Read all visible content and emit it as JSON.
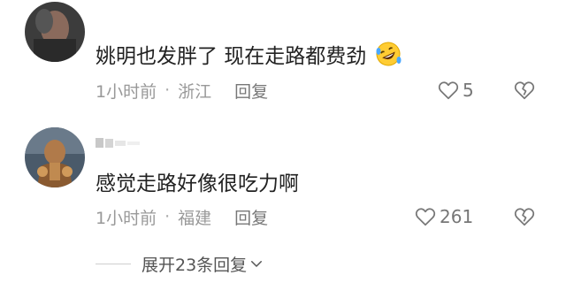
{
  "comments": [
    {
      "text": "姚明也发胖了 现在走路都费劲",
      "emoji": "rolling-on-floor-laughing",
      "time": "1小时前",
      "separator": "·",
      "location": "浙江",
      "reply_label": "回复",
      "like_count": "5",
      "avatar": "user-avatar-dark"
    },
    {
      "username": "",
      "text": "感觉走路好像很吃力啊",
      "time": "1小时前",
      "separator": "·",
      "location": "福建",
      "reply_label": "回复",
      "like_count": "261",
      "avatar": "user-avatar-figure"
    }
  ],
  "expand": {
    "label": "展开23条回复"
  },
  "icons": {
    "like": "heart-outline-icon",
    "dislike": "broken-heart-icon",
    "expand": "chevron-down-icon"
  },
  "colors": {
    "text": "#222222",
    "meta": "#999999",
    "icon": "#777777"
  }
}
